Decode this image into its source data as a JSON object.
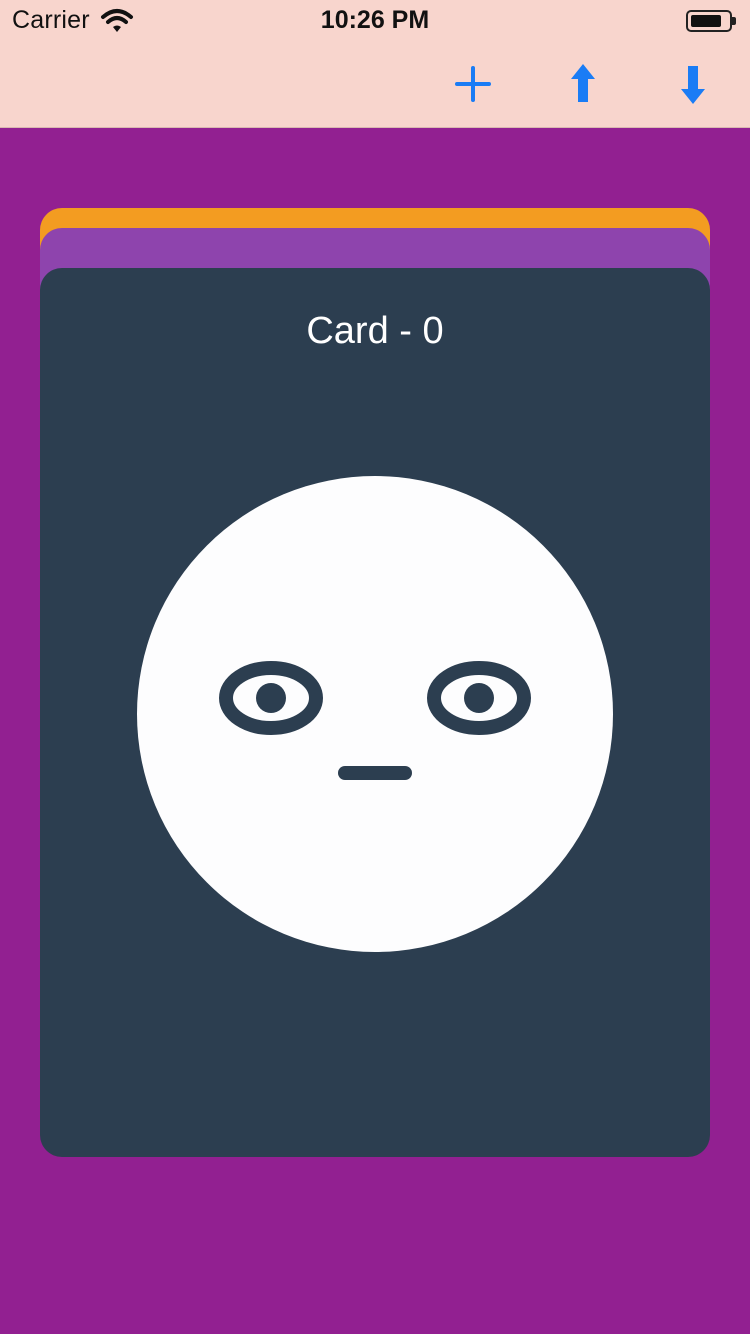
{
  "status_bar": {
    "carrier": "Carrier",
    "time": "10:26 PM",
    "wifi_icon": "wifi-icon",
    "battery_icon": "battery-icon"
  },
  "toolbar": {
    "add_icon": "plus-icon",
    "up_icon": "arrow-up-icon",
    "down_icon": "arrow-down-icon"
  },
  "colors": {
    "background": "#922091",
    "toolbar_background": "#f8d5cd",
    "toolbar_tint": "#1a7cf5",
    "card_front": "#2c3e50",
    "card_back_1": "#f39c21",
    "card_back_2": "#8e44ad",
    "face": "#fdfdfe"
  },
  "cards": {
    "front": {
      "title": "Card - 0",
      "icon": "neutral-face-icon"
    }
  }
}
